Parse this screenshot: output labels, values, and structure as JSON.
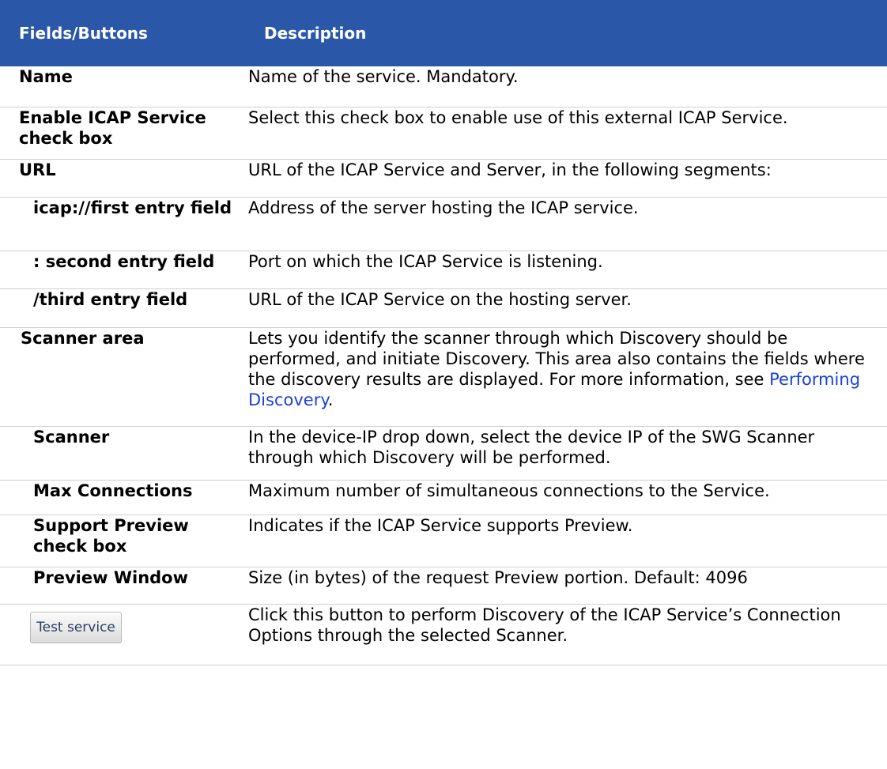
{
  "header": {
    "col_fields": "Fields/Buttons",
    "col_description": "Description"
  },
  "rows": [
    {
      "field": "Name",
      "description": "Name of the service. Mandatory."
    },
    {
      "field": "Enable ICAP Service check box",
      "description": "Select this check box to enable use of this external ICAP Service."
    },
    {
      "field": "URL",
      "description": "URL of the ICAP Service and Server, in the following segments:"
    },
    {
      "field": "icap://first entry field",
      "description": "Address of the server hosting the ICAP service."
    },
    {
      "field": ": second entry field",
      "description": "Port on which the ICAP Service is listening."
    },
    {
      "field": "/third entry field",
      "description": "URL of the ICAP Service on the hosting server."
    },
    {
      "field": "Scanner area",
      "description": "Lets you identify the scanner through which Discovery should be performed, and initiate Discovery. This area also contains the fields where the discovery results are displayed. For more information, see ",
      "link": "Performing Discovery",
      "after_link": "."
    },
    {
      "field": "Scanner",
      "description": "In the device-IP drop down, select the device IP of the SWG Scanner through which Discovery will be performed."
    },
    {
      "field": "Max Connections",
      "description": "Maximum number of simultaneous connections to the Service."
    },
    {
      "field": "Support Preview check box",
      "description": "Indicates if the ICAP Service supports Preview."
    },
    {
      "field": "Preview Window",
      "description": "Size (in bytes) of the request Preview portion. Default: 4096"
    },
    {
      "button_label": "Test service",
      "description": "Click this button to perform Discovery of the ICAP Service’s Connection Options through the selected Scanner."
    }
  ],
  "colors": {
    "header_bg": "#2a57a8",
    "header_text": "#ffffff",
    "link": "#1a40e0",
    "row_divider": "#cfcfcf"
  }
}
